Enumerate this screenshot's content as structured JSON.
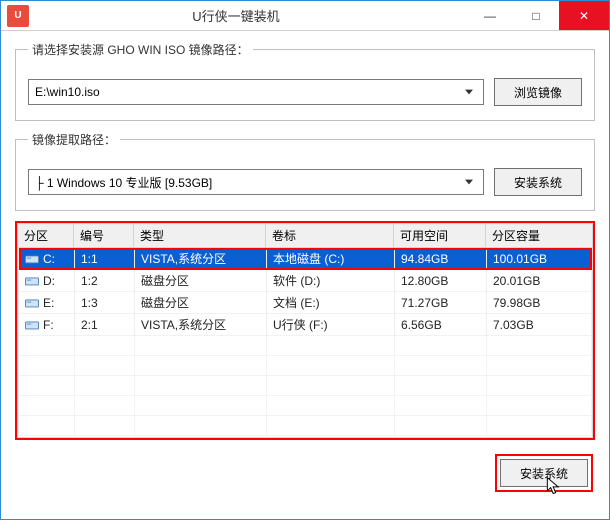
{
  "window_title": "U行侠一键装机",
  "app_icon_label": "U",
  "win_controls": {
    "min": "—",
    "max": "□",
    "close": "✕"
  },
  "groupbox1": {
    "legend": "请选择安装源 GHO WIN ISO 镜像路径：",
    "combo_value": "E:\\win10.iso",
    "browse_label": "浏览镜像"
  },
  "groupbox2": {
    "legend": "镜像提取路径：",
    "combo_value": "├ 1 Windows 10 专业版 [9.53GB]",
    "install_label": "安装系统"
  },
  "table": {
    "columns": [
      "分区",
      "编号",
      "类型",
      "卷标",
      "可用空间",
      "分区容量"
    ],
    "rows": [
      {
        "drive": "C:",
        "num": "1:1",
        "type": "VISTA,系统分区",
        "label": "本地磁盘 (C:)",
        "free": "94.84GB",
        "cap": "100.01GB",
        "selected": true
      },
      {
        "drive": "D:",
        "num": "1:2",
        "type": "磁盘分区",
        "label": "软件 (D:)",
        "free": "12.80GB",
        "cap": "20.01GB",
        "selected": false
      },
      {
        "drive": "E:",
        "num": "1:3",
        "type": "磁盘分区",
        "label": "文档 (E:)",
        "free": "71.27GB",
        "cap": "79.98GB",
        "selected": false
      },
      {
        "drive": "F:",
        "num": "2:1",
        "type": "VISTA,系统分区",
        "label": "U行侠 (F:)",
        "free": "6.56GB",
        "cap": "7.03GB",
        "selected": false
      }
    ]
  },
  "bottom_button": "安装系统"
}
